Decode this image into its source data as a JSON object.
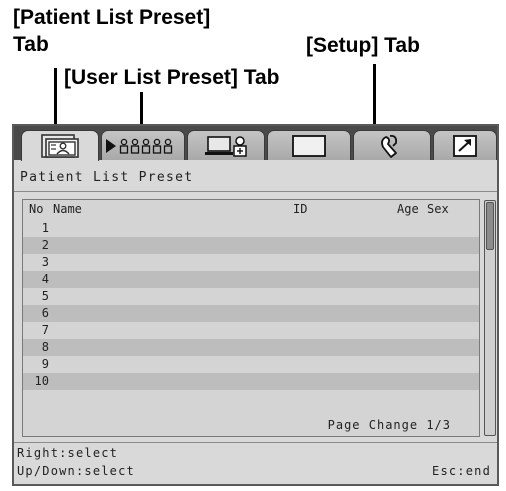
{
  "callouts": {
    "patient_tab_line1": "[Patient List Preset]",
    "patient_tab_line2": "Tab",
    "user_tab": "[User List Preset] Tab",
    "setup_tab": "[Setup] Tab"
  },
  "tabs": [
    {
      "icon": "patient-list-icon",
      "active": true
    },
    {
      "icon": "user-list-icon",
      "active": false
    },
    {
      "icon": "computer-user-icon",
      "active": false
    },
    {
      "icon": "blank-screen-icon",
      "active": false
    },
    {
      "icon": "wrench-icon",
      "active": false
    },
    {
      "icon": "export-arrow-icon",
      "active": false
    }
  ],
  "panel_title": "Patient List Preset",
  "list": {
    "headers": {
      "no": "No",
      "name": "Name",
      "id": "ID",
      "age": "Age",
      "sex": "Sex"
    },
    "rows": [
      "1",
      "2",
      "3",
      "4",
      "5",
      "6",
      "7",
      "8",
      "9",
      "10"
    ],
    "page_change": "Page Change 1/3"
  },
  "help": {
    "line1": "Right:select",
    "line2": "Up/Down:select",
    "esc": "Esc:end"
  },
  "colors": {
    "screen_bg": "#d9d9d9",
    "tabstrip_bg": "#4a4a4a",
    "row_alt": "#bdbdbd"
  }
}
